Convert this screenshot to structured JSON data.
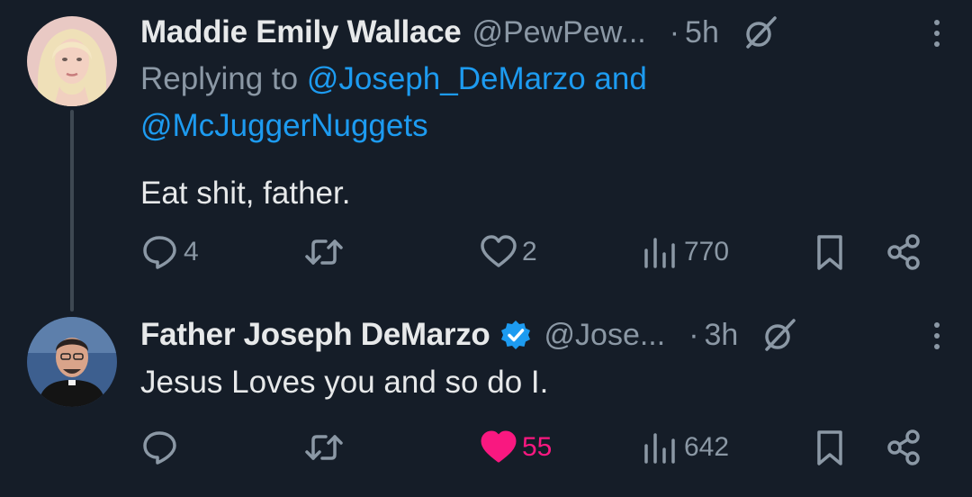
{
  "tweets": [
    {
      "author_name": "Maddie Emily Wallace",
      "handle": "@PewPew...",
      "separator": "·",
      "time": "5h",
      "replying_prefix": "Replying to",
      "replying_mentions_line1": "@Joseph_DeMarzo and",
      "replying_mentions_line2": "@McJuggerNuggets",
      "text": "Eat shit, father.",
      "replies": "4",
      "retweets": "",
      "likes": "2",
      "views": "770",
      "liked": false
    },
    {
      "author_name": "Father Joseph DeMarzo",
      "verified": true,
      "handle": "@Jose...",
      "separator": "·",
      "time": "3h",
      "text": "Jesus Loves you and so do I.",
      "replies": "",
      "retweets": "",
      "likes": "55",
      "views": "642",
      "liked": true
    }
  ],
  "colors": {
    "background": "#151d28",
    "primary_text": "#e7e9ea",
    "secondary_text": "#8b98a5",
    "link": "#1d9bf0",
    "like": "#f91880",
    "thread_line": "#3e4852"
  },
  "icons": [
    "reply-icon",
    "retweet-icon",
    "like-icon",
    "views-icon",
    "bookmark-icon",
    "share-icon",
    "grok-icon",
    "more-icon",
    "verified-badge-icon"
  ]
}
